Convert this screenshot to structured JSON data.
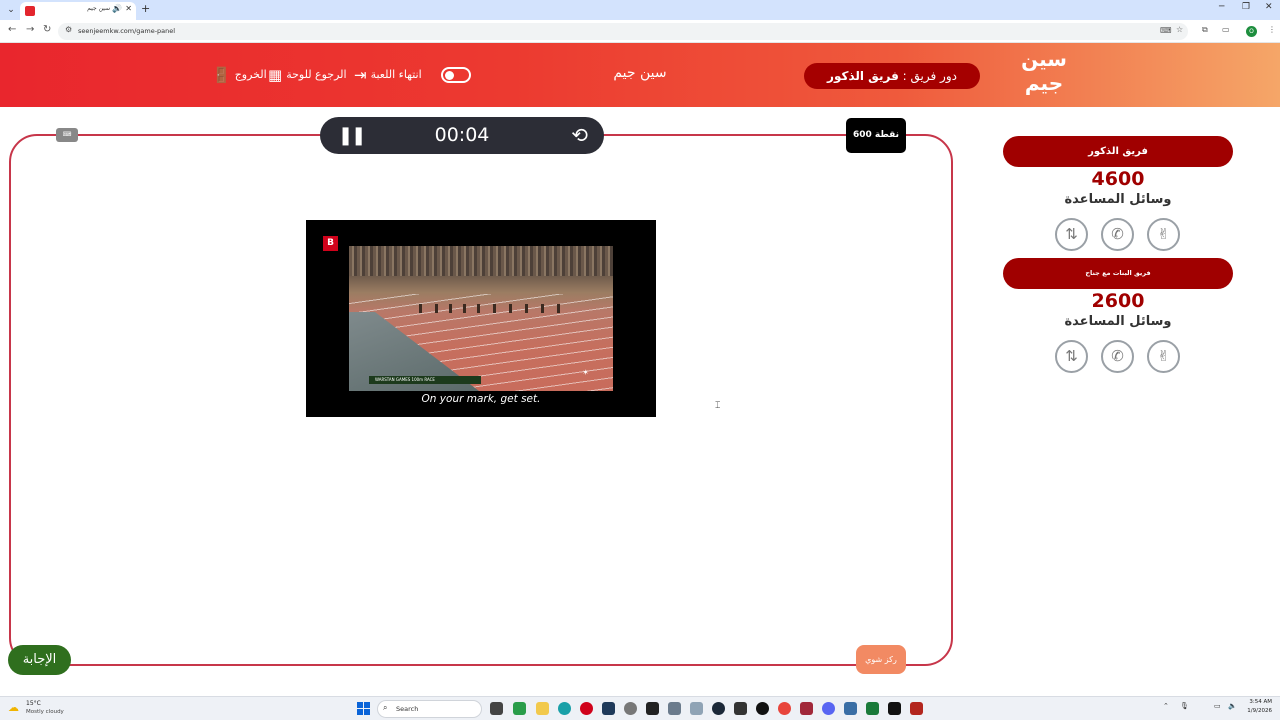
{
  "browser": {
    "tab_title": "سين جيم",
    "url": "seenjeemkw.com/game-panel",
    "profile_initial": "O"
  },
  "header": {
    "logo_line1": "سين",
    "logo_line2": "جيم",
    "turn_prefix": "دور فريق :",
    "turn_team": "فريق الذكور",
    "game_name": "سين جيم",
    "end_game_label": "انتهاء اللعبة",
    "back_to_board_label": "الرجوع للوحة",
    "exit_label": "الخروج"
  },
  "question": {
    "timer": "00:04",
    "points": "600 نقطة",
    "video_subtitle": "On your mark, get set.",
    "video_banner": "WARSTAN GAMES 100m RACE",
    "video_logo": "B",
    "answer_label": "الإجابة",
    "focus_label": "ركز شوي"
  },
  "teams": [
    {
      "name": "فريق الذكور",
      "score": "4600",
      "help_label": "وسائل المساعدة"
    },
    {
      "name": "فريق البنات مع جناح",
      "score": "2600",
      "help_label": "وسائل المساعدة"
    }
  ],
  "help_icons": [
    "hand-peace-icon",
    "phone-icon",
    "swap-icon"
  ],
  "taskbar": {
    "weather_temp": "15°C",
    "weather_desc": "Mostly cloudy",
    "search_placeholder": "Search",
    "time": "3:54 AM",
    "date": "1/9/2026"
  }
}
